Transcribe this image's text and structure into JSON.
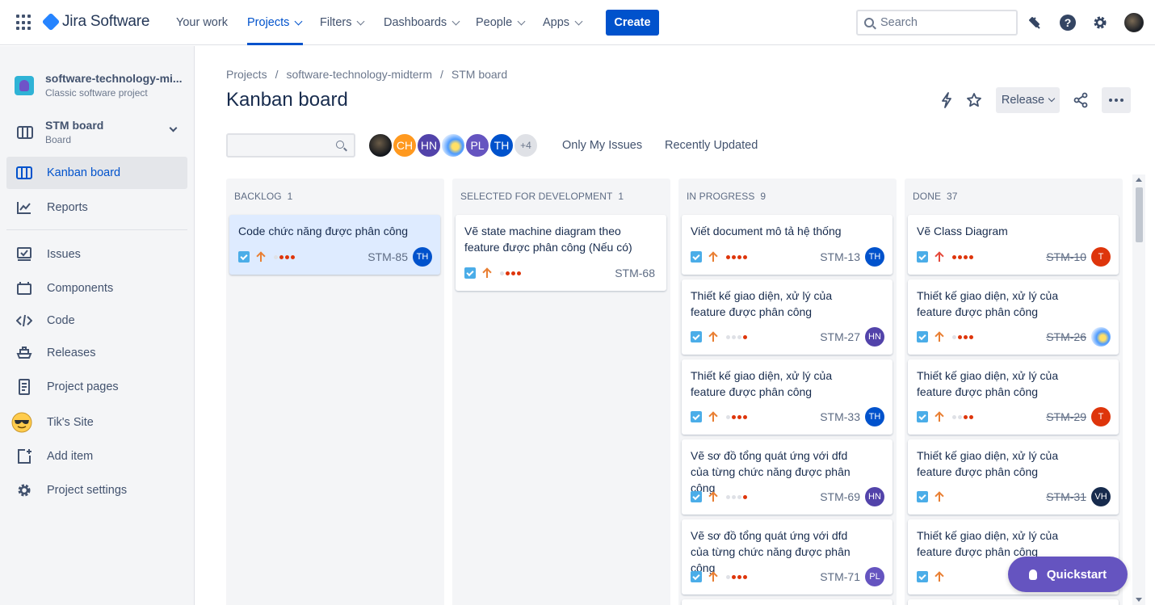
{
  "topnav": {
    "logo": "Jira Software",
    "items": [
      {
        "label": "Your work"
      },
      {
        "label": "Projects"
      },
      {
        "label": "Filters"
      },
      {
        "label": "Dashboards"
      },
      {
        "label": "People"
      },
      {
        "label": "Apps"
      }
    ],
    "active_item": "Projects",
    "create_label": "Create",
    "search_placeholder": "Search",
    "icons": [
      "app-switcher-icon",
      "notifications-icon",
      "help-icon",
      "settings-icon",
      "profile-avatar"
    ]
  },
  "sidebar": {
    "project_name": "software-technology-mi...",
    "project_type": "Classic software project",
    "board_name": "STM board",
    "board_type": "Board",
    "items": [
      {
        "label": "Kanban board",
        "icon": "board-icon",
        "selected": true
      },
      {
        "label": "Reports",
        "icon": "chart-line-icon"
      },
      {
        "label": "Issues",
        "icon": "issues-icon"
      },
      {
        "label": "Components",
        "icon": "components-icon"
      },
      {
        "label": "Code",
        "icon": "code-icon"
      },
      {
        "label": "Releases",
        "icon": "ship-icon"
      },
      {
        "label": "Project pages",
        "icon": "page-icon"
      },
      {
        "label": "Tik's Site",
        "icon": "sunglasses-emoji-icon"
      },
      {
        "label": "Add item",
        "icon": "add-item-icon"
      },
      {
        "label": "Project settings",
        "icon": "gear-icon"
      }
    ]
  },
  "breadcrumb": [
    "Projects",
    "/",
    "software-technology-midterm",
    "/",
    "STM board"
  ],
  "page_title": "Kanban board",
  "toolbar": {
    "release_label": "Release",
    "icons": [
      "lightning-icon",
      "star-icon",
      "share-icon",
      "more-icon"
    ]
  },
  "filters": {
    "avatars": [
      {
        "initials": "",
        "color": "#1b1f26"
      },
      {
        "initials": "CH",
        "color": "#ff991f"
      },
      {
        "initials": "HN",
        "color": "#5243aa"
      },
      {
        "initials": "",
        "color": "#4c9aff"
      },
      {
        "initials": "PL",
        "color": "#6554c0"
      },
      {
        "initials": "TH",
        "color": "#0052cc"
      },
      {
        "initials": "+4",
        "color": "#dfe1e6"
      }
    ],
    "quick_filters": [
      "Only My Issues",
      "Recently Updated"
    ]
  },
  "columns": [
    {
      "name": "BACKLOG",
      "count": "1",
      "cards": [
        {
          "summary": "Code chức năng được phân công",
          "key": "STM-85",
          "assignee": "TH",
          "assignee_color": "#0052cc",
          "priority": "high",
          "dots": 3,
          "highlight": true
        }
      ]
    },
    {
      "name": "SELECTED FOR DEVELOPMENT",
      "count": "1",
      "cards": [
        {
          "summary": "Vẽ state machine diagram theo feature được phân công (Nếu có)",
          "key": "STM-68",
          "assignee": "",
          "assignee_color": "",
          "priority": "high",
          "dots": 3
        }
      ]
    },
    {
      "name": "IN PROGRESS",
      "count": "9",
      "cards": [
        {
          "summary": "Viết document mô tả hệ thống",
          "key": "STM-13",
          "assignee": "TH",
          "assignee_color": "#0052cc",
          "priority": "high",
          "dots": 4
        },
        {
          "summary": "Thiết kế giao diện, xử lý của feature được phân công",
          "key": "STM-27",
          "assignee": "HN",
          "assignee_color": "#5243aa",
          "priority": "high",
          "dots": 1
        },
        {
          "summary": "Thiết kế giao diện, xử lý của feature được phân công",
          "key": "STM-33",
          "assignee": "TH",
          "assignee_color": "#0052cc",
          "priority": "high",
          "dots": 3
        },
        {
          "summary": "Vẽ sơ đồ tổng quát ứng với dfd của từng chức năng được phân công",
          "key": "STM-69",
          "assignee": "HN",
          "assignee_color": "#5243aa",
          "priority": "high",
          "dots": 1
        },
        {
          "summary": "Vẽ sơ đồ tổng quát ứng với dfd của từng chức năng được phân công",
          "key": "STM-71",
          "assignee": "PL",
          "assignee_color": "#6554c0",
          "priority": "high",
          "dots": 3
        }
      ]
    },
    {
      "name": "DONE",
      "count": "37",
      "cards": [
        {
          "summary": "Vẽ Class Diagram",
          "key": "STM-10",
          "assignee": "T",
          "assignee_color": "#de350b",
          "priority": "highest",
          "dots": 4,
          "done": true
        },
        {
          "summary": "Thiết kế giao diện, xử lý của feature được phân công",
          "key": "STM-26",
          "assignee": "",
          "assignee_color": "#4c9aff",
          "priority": "high",
          "dots": 3,
          "done": true
        },
        {
          "summary": "Thiết kế giao diện, xử lý của feature được phân công",
          "key": "STM-29",
          "assignee": "T",
          "assignee_color": "#de350b",
          "priority": "high",
          "dots": 2,
          "done": true
        },
        {
          "summary": "Thiết kế giao diện, xử lý của feature được phân công",
          "key": "STM-31",
          "assignee": "VH",
          "assignee_color": "#172b4d",
          "priority": "high",
          "dots": 0,
          "done": true
        },
        {
          "summary": "Thiết kế giao diện, xử lý của feature được phân công",
          "key": "",
          "assignee": "",
          "assignee_color": "",
          "priority": "high",
          "dots": 0,
          "done": true
        }
      ]
    }
  ],
  "quickstart_label": "Quickstart"
}
